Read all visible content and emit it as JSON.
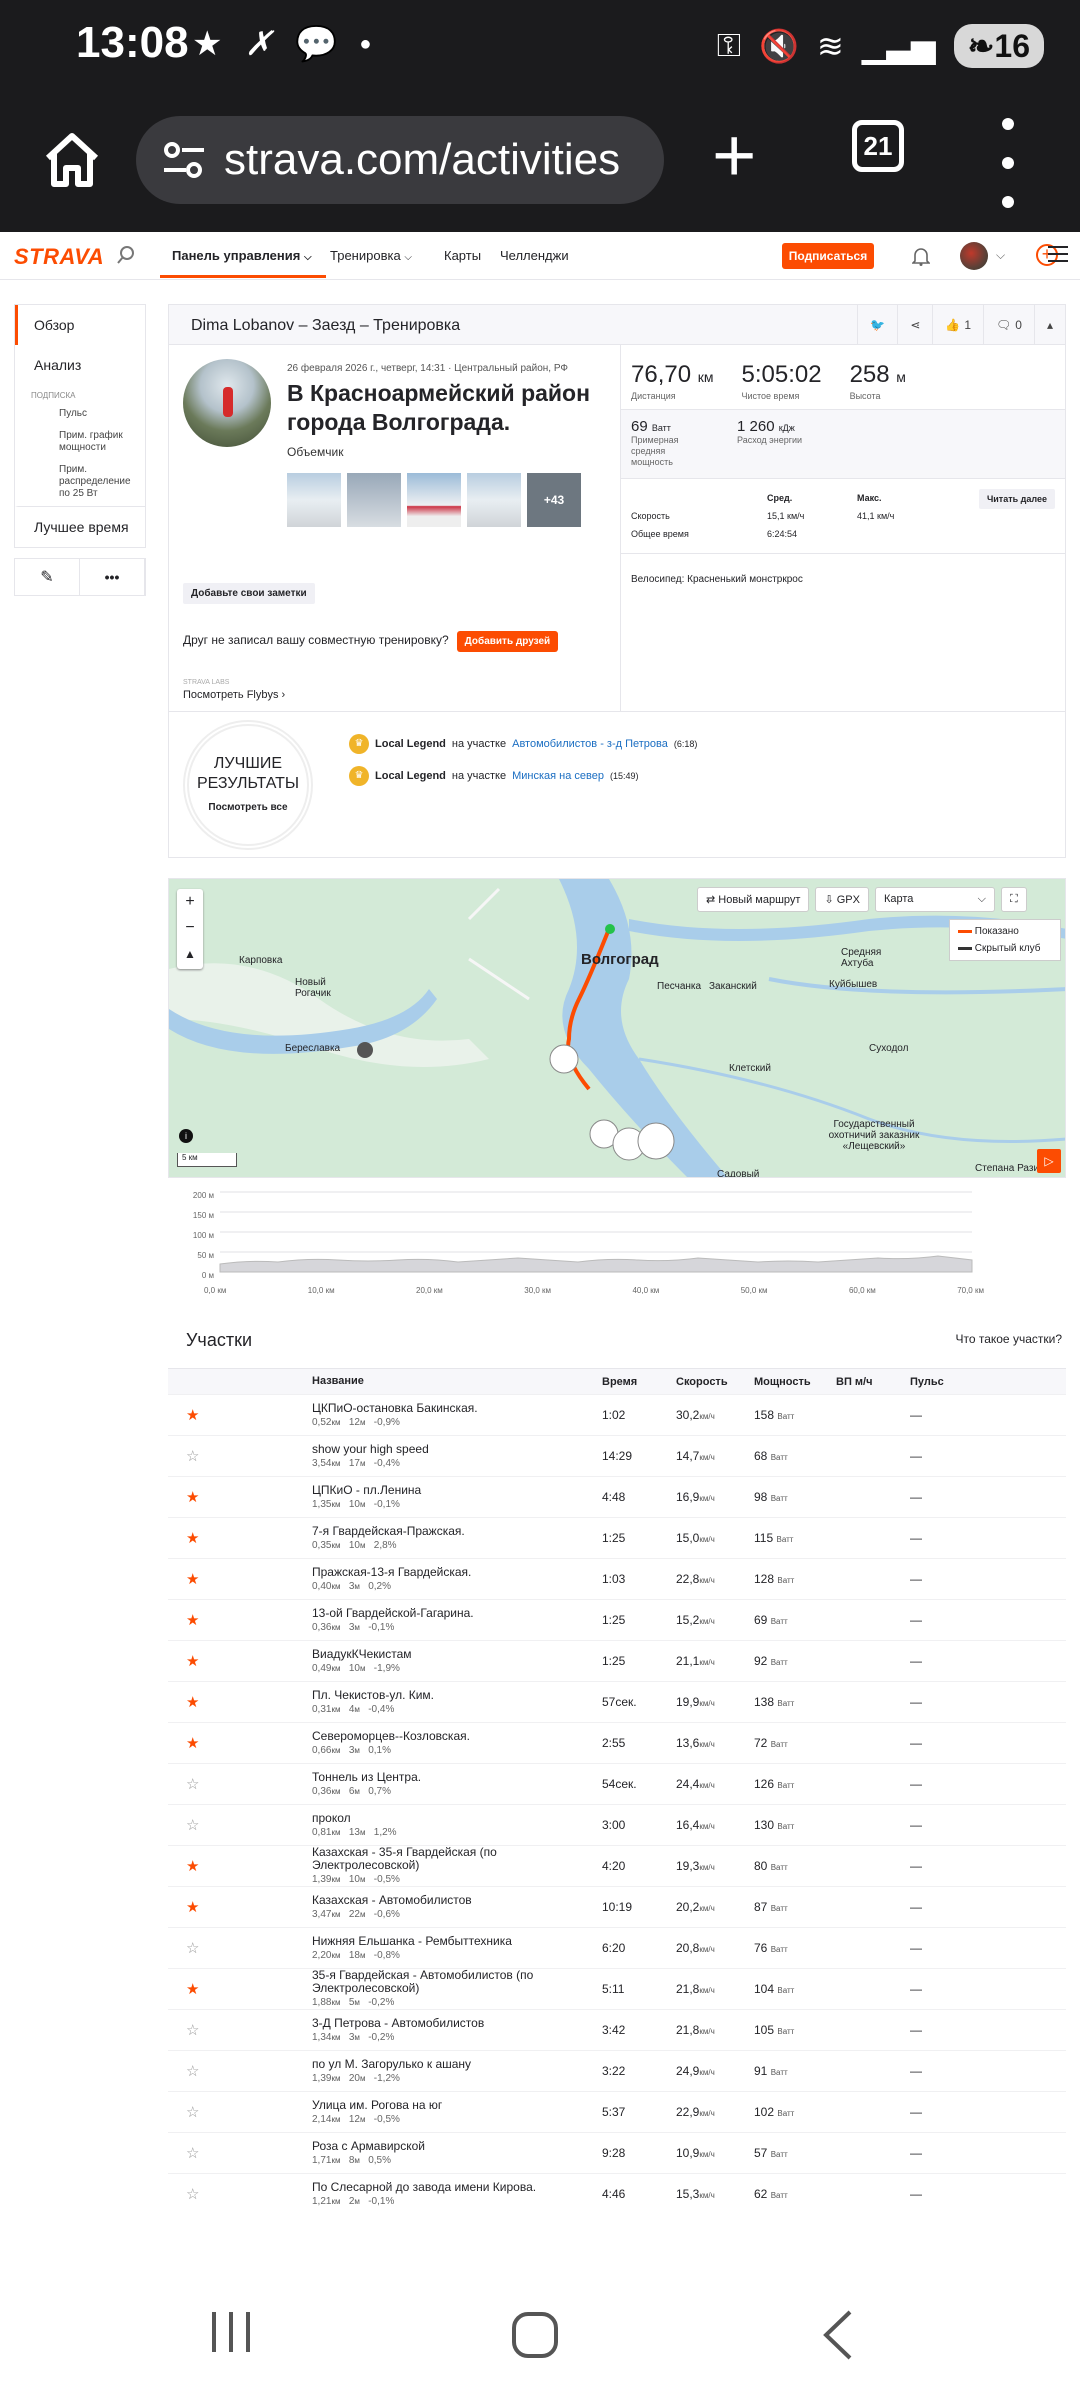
{
  "status": {
    "time": "13:08",
    "battery": "16"
  },
  "browser": {
    "url": "strava.com/activities",
    "tab_count": "21"
  },
  "nav": {
    "logo": "STRAVA",
    "dashboard": "Панель управления",
    "training": "Тренировка",
    "maps": "Карты",
    "challenges": "Челленджи",
    "subscribe": "Подписаться"
  },
  "sidebar": {
    "overview": "Обзор",
    "analysis": "Анализ",
    "sub_header": "ПОДПИСКА",
    "hr": "Пульс",
    "power_curve": "Прим. график мощности",
    "power_dist": "Прим. распределение по 25 Вт",
    "best": "Лучшее время"
  },
  "activity": {
    "header": "Dima Lobanov – Заезд – Тренировка",
    "kudos": "1",
    "comments": "0",
    "meta": "26 февраля 2026 г., четверг, 14:31 · Центральный район, РФ",
    "title": "В Красноармейский район города Волгограда.",
    "bike_name": "Объемчик",
    "more_photos": "+43",
    "notes": "Добавьте свои заметки",
    "friend_q": "Друг не записал вашу совместную тренировку?",
    "add_friends": "Добавить друзей",
    "labs": "STRAVA LABS",
    "flyby": "Посмотреть Flybys",
    "distance": "76,70",
    "distance_unit": "км",
    "distance_label": "Дистанция",
    "moving": "5:05:02",
    "moving_label": "Чистое время",
    "elev": "258",
    "elev_unit": "м",
    "elev_label": "Высота",
    "power": "69",
    "power_unit": "Ватт",
    "power_label": "Примерная средняя мощность",
    "energy": "1 260",
    "energy_unit": "кДж",
    "energy_label": "Расход энергии",
    "avg_h": "Сред.",
    "max_h": "Макс.",
    "read_more": "Читать далее",
    "speed_label": "Скорость",
    "speed_avg": "15,1 км/ч",
    "speed_max": "41,1 км/ч",
    "elapsed_label": "Общее время",
    "elapsed": "6:24:54",
    "bicycle": "Велосипед: Красненький монстркрос"
  },
  "best": {
    "title": "ЛУЧШИЕ РЕЗУЛЬТАТЫ",
    "see_all": "Посмотреть все",
    "items": [
      {
        "bold": "Local Legend",
        "mid": "на участке",
        "link": "Автомобилистов - з-д Петрова",
        "time": "(6:18)"
      },
      {
        "bold": "Local Legend",
        "mid": "на участке",
        "link": "Минская на север",
        "time": "(15:49)"
      }
    ]
  },
  "map": {
    "new_route": "Новый маршрут",
    "gpx": "GPX",
    "layer": "Карта",
    "legend_shown": "Показано",
    "legend_hidden": "Скрытый клуб",
    "scale": "5 км",
    "labels": [
      {
        "t": "Волгоград"
      },
      {
        "t": "Карповка"
      },
      {
        "t": "Новый Рогачик"
      },
      {
        "t": "Береславка"
      },
      {
        "t": "Песчанка"
      },
      {
        "t": "Заканский"
      },
      {
        "t": "Средняя Ахтуба"
      },
      {
        "t": "Куйбышев"
      },
      {
        "t": "Суходол"
      },
      {
        "t": "Клетский"
      },
      {
        "t": "Государственный охотничий заказник «Лещевский»"
      },
      {
        "t": "Садовый"
      },
      {
        "t": "Степана Разина"
      }
    ]
  },
  "elevation": {
    "y_ticks": [
      "200 м",
      "150 м",
      "100 м",
      "50 м",
      "0 м"
    ],
    "x_ticks": [
      "0,0 км",
      "10,0 км",
      "20,0 км",
      "30,0 км",
      "40,0 км",
      "50,0 км",
      "60,0 км",
      "70,0 км"
    ]
  },
  "segments": {
    "title": "Участки",
    "what": "Что такое участки?",
    "columns": {
      "name": "Название",
      "time": "Время",
      "speed": "Скорость",
      "power": "Мощность",
      "vam": "ВП м/ч",
      "hr": "Пульс"
    },
    "rows": [
      {
        "star": true,
        "name": "ЦКПиО-остановка Бакинская.",
        "dist": "0,52",
        "elev": "12",
        "grade": "-0,9%",
        "time": "1:02",
        "speed": "30,2",
        "power": "158",
        "hr": "—"
      },
      {
        "star": false,
        "name": "show your high speed",
        "dist": "3,54",
        "elev": "17",
        "grade": "-0,4%",
        "time": "14:29",
        "speed": "14,7",
        "power": "68",
        "hr": "—"
      },
      {
        "star": true,
        "name": "ЦПКиО - пл.Ленина",
        "dist": "1,35",
        "elev": "10",
        "grade": "-0,1%",
        "time": "4:48",
        "speed": "16,9",
        "power": "98",
        "hr": "—"
      },
      {
        "star": true,
        "name": "7-я Гвардейская-Пражская.",
        "dist": "0,35",
        "elev": "10",
        "grade": "2,8%",
        "time": "1:25",
        "speed": "15,0",
        "power": "115",
        "hr": "—"
      },
      {
        "star": true,
        "name": "Пражская-13-я Гвардейская.",
        "dist": "0,40",
        "elev": "3",
        "grade": "0,2%",
        "time": "1:03",
        "speed": "22,8",
        "power": "128",
        "hr": "—"
      },
      {
        "star": true,
        "name": "13-ой Гвардейской-Гагарина.",
        "dist": "0,36",
        "elev": "3",
        "grade": "-0,1%",
        "time": "1:25",
        "speed": "15,2",
        "power": "69",
        "hr": "—"
      },
      {
        "star": true,
        "name": "ВиадукКЧекистам",
        "dist": "0,49",
        "elev": "10",
        "grade": "-1,9%",
        "time": "1:25",
        "speed": "21,1",
        "power": "92",
        "hr": "—"
      },
      {
        "star": true,
        "name": "Пл. Чекистов-ул. Ким.",
        "dist": "0,31",
        "elev": "4",
        "grade": "-0,4%",
        "time": "57сек.",
        "speed": "19,9",
        "power": "138",
        "hr": "—"
      },
      {
        "star": true,
        "name": "Североморцев--Козловская.",
        "dist": "0,66",
        "elev": "3",
        "grade": "0,1%",
        "time": "2:55",
        "speed": "13,6",
        "power": "72",
        "hr": "—"
      },
      {
        "star": false,
        "name": "Тоннель из Центра.",
        "dist": "0,36",
        "elev": "6",
        "grade": "0,7%",
        "time": "54сек.",
        "speed": "24,4",
        "power": "126",
        "hr": "—"
      },
      {
        "star": false,
        "name": "прокол",
        "dist": "0,81",
        "elev": "13",
        "grade": "1,2%",
        "time": "3:00",
        "speed": "16,4",
        "power": "130",
        "hr": "—"
      },
      {
        "star": true,
        "name": "Казахская - 35-я Гвардейская (по Электролесовской)",
        "dist": "1,39",
        "elev": "10",
        "grade": "-0,5%",
        "time": "4:20",
        "speed": "19,3",
        "power": "80",
        "hr": "—"
      },
      {
        "star": true,
        "name": "Казахская - Автомобилистов",
        "dist": "3,47",
        "elev": "22",
        "grade": "-0,6%",
        "time": "10:19",
        "speed": "20,2",
        "power": "87",
        "hr": "—"
      },
      {
        "star": false,
        "name": "Нижняя Ельшанка - Рембыттехника",
        "dist": "2,20",
        "elev": "18",
        "grade": "-0,8%",
        "time": "6:20",
        "speed": "20,8",
        "power": "76",
        "hr": "—"
      },
      {
        "star": true,
        "name": "35-я Гвардейская - Автомобилистов (по Электролесовской)",
        "dist": "1,88",
        "elev": "5",
        "grade": "-0,2%",
        "time": "5:11",
        "speed": "21,8",
        "power": "104",
        "hr": "—"
      },
      {
        "star": false,
        "name": "3-Д Петрова - Автомобилистов",
        "dist": "1,34",
        "elev": "3",
        "grade": "-0,2%",
        "time": "3:42",
        "speed": "21,8",
        "power": "105",
        "hr": "—"
      },
      {
        "star": false,
        "name": "по ул М. Загорулько к ашану",
        "dist": "1,39",
        "elev": "20",
        "grade": "-1,2%",
        "time": "3:22",
        "speed": "24,9",
        "power": "91",
        "hr": "—"
      },
      {
        "star": false,
        "name": "Улица им. Рогова на юг",
        "dist": "2,14",
        "elev": "12",
        "grade": "-0,5%",
        "time": "5:37",
        "speed": "22,9",
        "power": "102",
        "hr": "—"
      },
      {
        "star": false,
        "name": "Роза с Армавирской",
        "dist": "1,71",
        "elev": "8",
        "grade": "0,5%",
        "time": "9:28",
        "speed": "10,9",
        "power": "57",
        "hr": "—"
      },
      {
        "star": false,
        "name": "По Слесарной до завода имени Кирова.",
        "dist": "1,21",
        "elev": "2",
        "grade": "-0,1%",
        "time": "4:46",
        "speed": "15,3",
        "power": "62",
        "hr": "—"
      }
    ],
    "units": {
      "km": "км",
      "m": "м",
      "kmh": "км/ч",
      "watt": "Ватт"
    }
  }
}
